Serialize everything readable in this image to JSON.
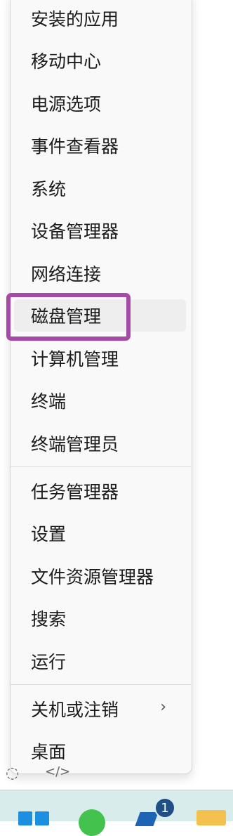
{
  "menu": {
    "items": [
      {
        "label": "安装的应用"
      },
      {
        "label": "移动中心"
      },
      {
        "label": "电源选项"
      },
      {
        "label": "事件查看器"
      },
      {
        "label": "系统"
      },
      {
        "label": "设备管理器"
      },
      {
        "label": "网络连接"
      },
      {
        "label": "磁盘管理",
        "state": "hover",
        "annotated": true
      },
      {
        "label": "计算机管理"
      },
      {
        "label": "终端"
      },
      {
        "label": "终端管理员"
      },
      {
        "label": "任务管理器"
      },
      {
        "label": "设置"
      },
      {
        "label": "文件资源管理器"
      },
      {
        "label": "搜索"
      },
      {
        "label": "运行"
      },
      {
        "label": "关机或注销",
        "submenu": true,
        "chevron": "›"
      },
      {
        "label": "桌面"
      }
    ]
  },
  "annotation": {
    "color": "#a64aa8"
  },
  "background_fragments": {
    "left": "◌",
    "right": "</>"
  },
  "taskbar": {
    "icons": [
      "windows-start-icon",
      "wechat-icon",
      "app-icon",
      "file-explorer-icon"
    ],
    "badge_count": "1"
  }
}
